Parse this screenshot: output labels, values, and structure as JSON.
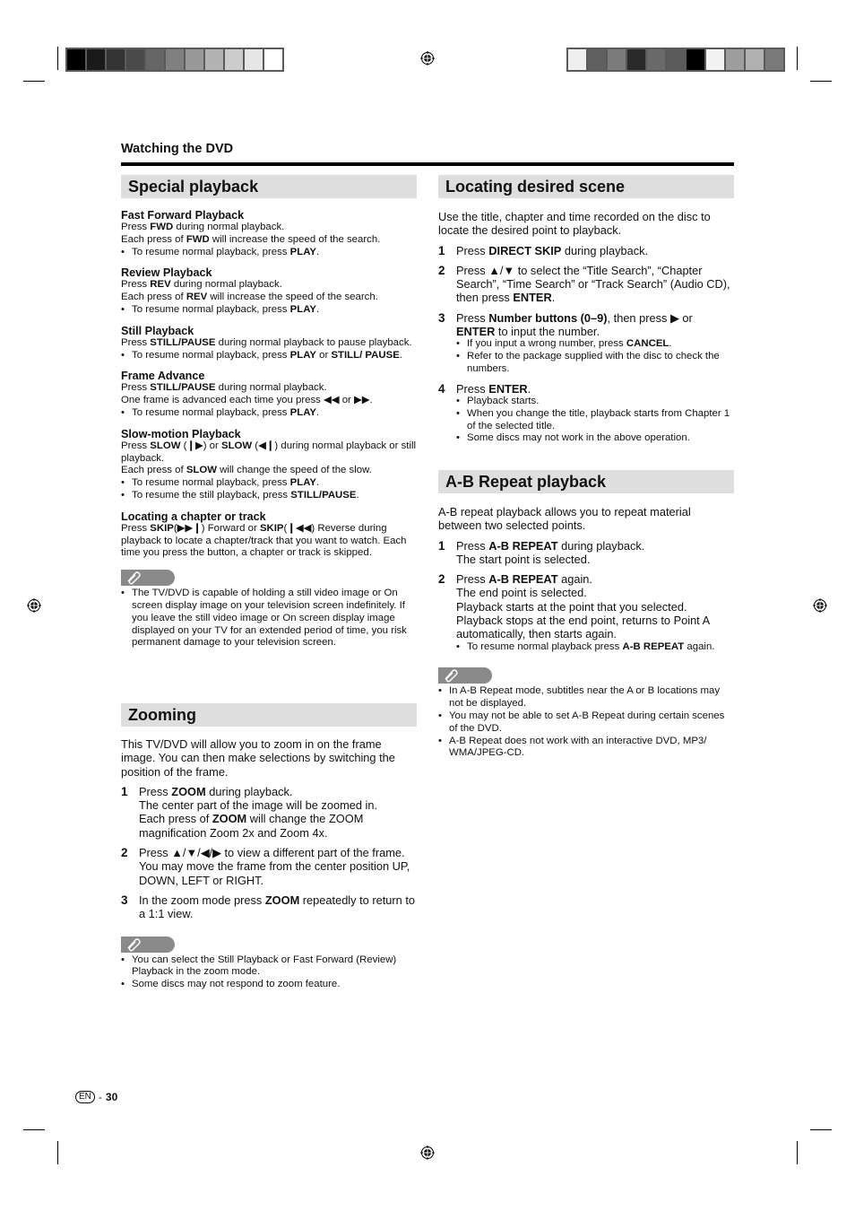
{
  "print_marks": {
    "left_swatches": [
      "#000000",
      "#1a1a1a",
      "#333333",
      "#4a4a4a",
      "#666666",
      "#808080",
      "#999999",
      "#b3b3b3",
      "#cccccc",
      "#e6e6e6",
      "#ffffff"
    ],
    "right_swatches": [
      "#eeeeee",
      "#5f5f5f",
      "#7b7b7b",
      "#2a2a2a",
      "#6a6a6a",
      "#5a5a5a",
      "#000000",
      "#f2f2f2",
      "#9e9e9e",
      "#b0b0b0",
      "#7a7a7a"
    ]
  },
  "header": {
    "running_head": "Watching the DVD"
  },
  "special_playback": {
    "title": "Special playback",
    "blocks": [
      {
        "heading": "Fast Forward Playback",
        "lines": [
          "Press |FWD| during normal playback.",
          "Each press of |FWD| will increase the speed of the search."
        ],
        "bullets": [
          "To resume normal playback, press |PLAY|."
        ]
      },
      {
        "heading": "Review Playback",
        "lines": [
          "Press |REV| during normal playback.",
          "Each press of |REV| will increase the speed of the search."
        ],
        "bullets": [
          "To resume normal playback, press |PLAY|."
        ]
      },
      {
        "heading": "Still Playback",
        "lines": [
          "Press |STILL/PAUSE| during normal playback to pause playback."
        ],
        "bullets": [
          "To resume normal playback, press |PLAY| or |STILL/ PAUSE|."
        ]
      },
      {
        "heading": "Frame Advance",
        "lines": [
          "Press |STILL/PAUSE| during normal playback.",
          "One frame is advanced each time you press ◀◀ or ▶▶."
        ],
        "bullets": [
          "To resume normal playback, press |PLAY|."
        ]
      },
      {
        "heading": "Slow-motion Playback",
        "lines": [
          "Press |SLOW| (❙▶) or |SLOW| (◀❙) during normal playback or still playback.",
          "Each press of |SLOW| will change the speed of the slow."
        ],
        "bullets": [
          "To resume normal playback, press |PLAY|.",
          "To resume the still playback, press |STILL/PAUSE|."
        ]
      },
      {
        "heading": "Locating a chapter or track",
        "lines": [
          "Press |SKIP|(▶▶❙) Forward or |SKIP|(❙◀◀) Reverse during playback to locate a chapter/track that you want to watch. Each time you press the button, a chapter or track is skipped."
        ],
        "bullets": []
      }
    ],
    "note_icon": "paperclip-icon",
    "notes": [
      "The TV/DVD is capable of holding a still video image or On screen display image on your television screen indefinitely. If you leave the still video image or On screen display image displayed on your TV for an extended period of time, you risk permanent damage to your television screen."
    ]
  },
  "zooming": {
    "title": "Zooming",
    "intro": "This TV/DVD will allow you to zoom in on the frame image. You can then make selections by switching the position of the frame.",
    "steps": [
      {
        "num": "1",
        "text": "Press |ZOOM| during playback.\nThe center part of the image will be zoomed in.\nEach press of |ZOOM| will change the ZOOM magnification Zoom 2x and Zoom 4x.",
        "bullets": []
      },
      {
        "num": "2",
        "text": "Press ▲/▼/◀/▶ to view a different part of the frame.\nYou may move the frame from the center position UP, DOWN, LEFT or RIGHT.",
        "bullets": []
      },
      {
        "num": "3",
        "text": "In the zoom mode press |ZOOM| repeatedly to return to a 1:1 view.",
        "bullets": []
      }
    ],
    "notes": [
      "You can select the Still Playback or Fast Forward (Review) Playback in the zoom mode.",
      "Some discs may not respond to zoom feature."
    ]
  },
  "locating_scene": {
    "title": "Locating desired scene",
    "intro": "Use the title, chapter and time recorded on the disc to locate the desired point to playback.",
    "steps": [
      {
        "num": "1",
        "text": "Press |DIRECT SKIP| during playback.",
        "bullets": []
      },
      {
        "num": "2",
        "text": "Press ▲/▼ to select the “Title Search”, “Chapter Search”, “Time Search” or “Track Search” (Audio CD), then press |ENTER|.",
        "bullets": []
      },
      {
        "num": "3",
        "text": "Press |Number buttons (0–9)|, then press ▶ or |ENTER| to input the number.",
        "bullets": [
          "If you input a wrong number, press |CANCEL|.",
          "Refer to the package supplied with the disc to check the numbers."
        ]
      },
      {
        "num": "4",
        "text": "Press |ENTER|.",
        "bullets": [
          "Playback starts.",
          "When you change the title, playback starts from Chapter 1 of the selected title.",
          "Some discs may not work in the above operation."
        ]
      }
    ]
  },
  "ab_repeat": {
    "title": "A-B Repeat playback",
    "intro": "A-B repeat playback allows you to repeat material between two selected points.",
    "steps": [
      {
        "num": "1",
        "text": "Press |A-B REPEAT| during playback.\nThe start point is selected.",
        "bullets": []
      },
      {
        "num": "2",
        "text": "Press |A-B REPEAT| again.\nThe end point is selected.\nPlayback starts at the point that you selected.\nPlayback stops at the end point, returns to Point A automatically, then starts again.",
        "bullets": [
          "To resume normal playback press |A-B REPEAT| again."
        ]
      }
    ],
    "notes": [
      "In A-B Repeat mode, subtitles near the A or B locations may not be displayed.",
      "You may not be able to set A-B Repeat during certain scenes of the DVD.",
      "A-B Repeat does not work with an interactive DVD, MP3/ WMA/JPEG-CD."
    ]
  },
  "footer": {
    "lang": "EN",
    "separator": "-",
    "page_number": "30"
  }
}
